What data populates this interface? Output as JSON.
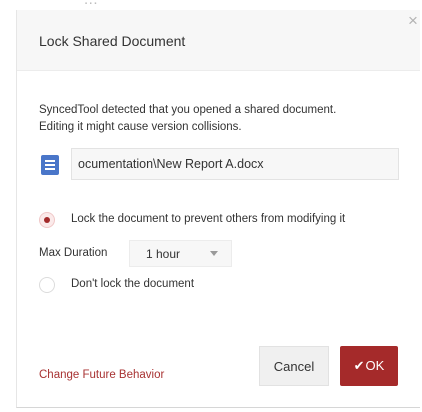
{
  "background_text": "...",
  "dialog": {
    "title": "Lock Shared Document",
    "close_icon": "close-icon",
    "message_line1": "SyncedTool detected that you opened a shared document.",
    "message_line2": "Editing it might cause version collisions.",
    "file_icon": "document-icon",
    "file_path": "ocumentation\\New Report A.docx",
    "options": [
      {
        "label": "Lock the document to prevent others from modifying it",
        "selected": true
      },
      {
        "label": "Don't lock the document",
        "selected": false
      }
    ],
    "max_duration": {
      "label": "Max Duration",
      "value": "1 hour"
    },
    "change_behavior_link": "Change Future Behavior",
    "cancel_label": "Cancel",
    "ok_icon": "check-icon",
    "ok_label": "OK"
  },
  "colors": {
    "accent": "#a52a2a",
    "link": "#a83232",
    "doc_icon": "#4a76c9"
  }
}
